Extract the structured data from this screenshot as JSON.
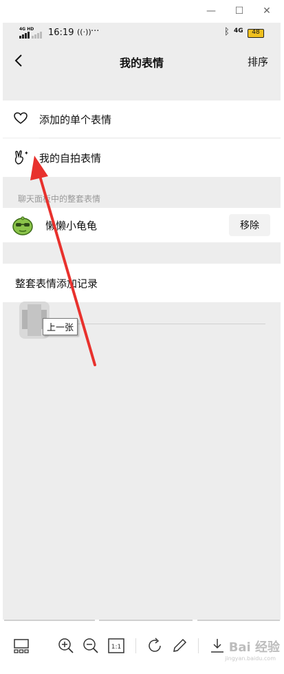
{
  "statusbar": {
    "network_left": "4G HD",
    "time": "16:19",
    "ellipsis": "···",
    "network_right": "4G",
    "battery": "48"
  },
  "nav": {
    "title": "我的表情",
    "sort_label": "排序"
  },
  "items": {
    "added_single": "添加的单个表情",
    "selfie": "我的自拍表情"
  },
  "section_label": "聊天面板中的整套表情",
  "sticker_pack": {
    "name": "懒懒小龟龟",
    "remove_label": "移除"
  },
  "history_label": "整套表情添加记录",
  "tooltip": "上一张",
  "watermark": "Bai 经验",
  "watermark_sub": "jingyan.baidu.com",
  "colors": {
    "accent_arrow": "#e8312d",
    "background": "#ededed"
  }
}
